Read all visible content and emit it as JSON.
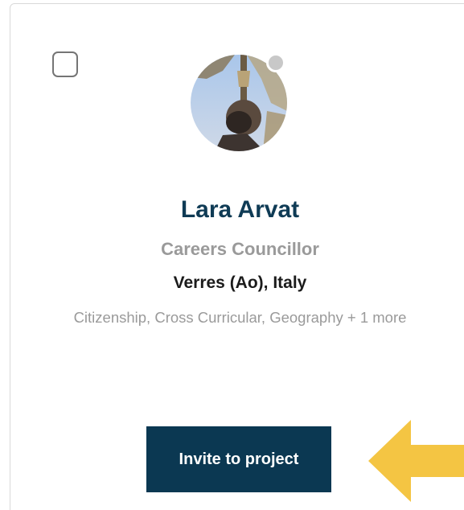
{
  "profile_card": {
    "name": "Lara Arvat",
    "role": "Careers Councillor",
    "location": "Verres (Ao), Italy",
    "subjects": "Citizenship, Cross Curricular, Geography + 1 more",
    "online_status": "offline",
    "invite_button_label": "Invite to project",
    "select_checked": false
  },
  "colors": {
    "name_color": "#0f3b55",
    "button_bg": "#0b3852",
    "arrow_color": "#f4c543",
    "status_dot": "#c8c8c8"
  },
  "icons": {
    "pointer_arrow": "left-arrow-icon"
  }
}
